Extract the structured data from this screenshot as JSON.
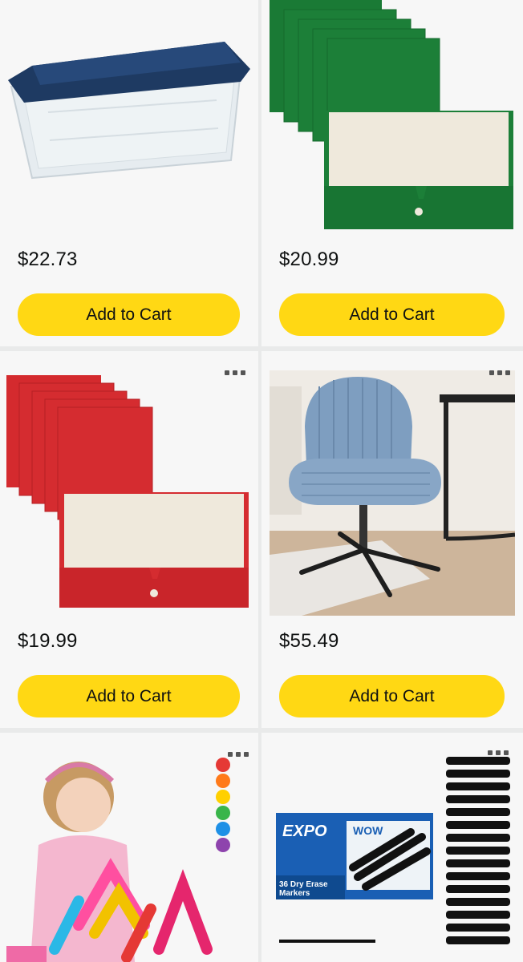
{
  "products": [
    {
      "price": "$22.73",
      "cta": "Add to Cart",
      "image": "storage-bin-blue-lid"
    },
    {
      "price": "$20.99",
      "cta": "Add to Cart",
      "image": "green-pocket-folders"
    },
    {
      "price": "$19.99",
      "cta": "Add to Cart",
      "image": "red-pocket-folders"
    },
    {
      "price": "$55.49",
      "cta": "Add to Cart",
      "image": "blue-office-chair"
    },
    {
      "image": "kids-building-blocks"
    },
    {
      "image": "expo-dry-erase-markers",
      "brand": "EXPO",
      "sub": "WOW",
      "count_label": "36 Dry Erase Markers"
    }
  ],
  "icons": {
    "more": "more-options-icon"
  },
  "colors": {
    "button": "#ffd814",
    "card": "#f7f7f7",
    "divider": "#e9eaea"
  }
}
